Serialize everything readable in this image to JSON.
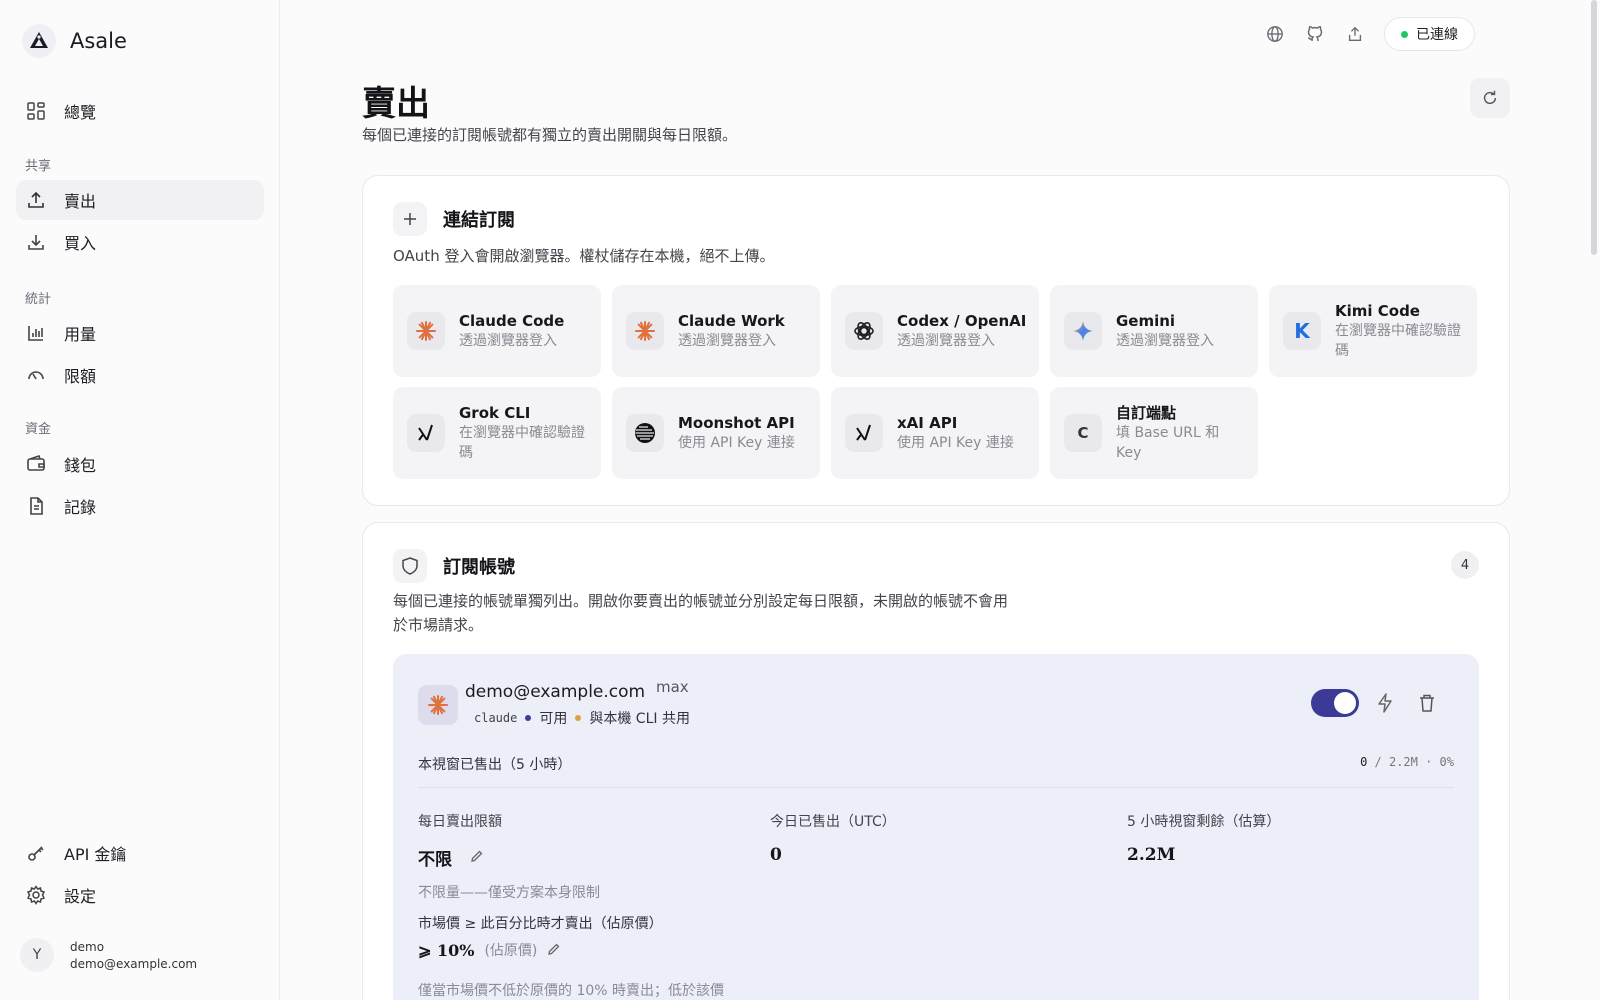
{
  "app": {
    "name": "Asale"
  },
  "sidebar": {
    "overview": "總覽",
    "sections": {
      "share": "共享",
      "stats": "統計",
      "funds": "資金"
    },
    "sell": "賣出",
    "buy": "買入",
    "usage": "用量",
    "limits": "限額",
    "wallet": "錢包",
    "records": "記錄",
    "api_keys": "API 金鑰",
    "settings": "設定",
    "user": {
      "avatar": "Y",
      "name": "demo",
      "email": "demo@example.com"
    }
  },
  "topbar": {
    "status": "已連線",
    "status_color": "#22c55e"
  },
  "page": {
    "title": "賣出",
    "subtitle": "每個已連接的訂閱帳號都有獨立的賣出開關與每日限額。"
  },
  "connect": {
    "title": "連結訂閱",
    "desc": "OAuth 登入會開啟瀏覽器。權杖儲存在本機，絕不上傳。",
    "providers": [
      {
        "name": "Claude Code",
        "sub": "透過瀏覽器登入",
        "icon": "claude-icon"
      },
      {
        "name": "Claude Work",
        "sub": "透過瀏覽器登入",
        "icon": "claude-icon"
      },
      {
        "name": "Codex / OpenAI",
        "sub": "透過瀏覽器登入",
        "icon": "openai-icon"
      },
      {
        "name": "Gemini",
        "sub": "透過瀏覽器登入",
        "icon": "gemini-icon"
      },
      {
        "name": "Kimi Code",
        "sub": "在瀏覽器中確認驗證碼",
        "icon": "kimi-icon",
        "glyph": "K"
      },
      {
        "name": "Grok CLI",
        "sub": "在瀏覽器中確認驗證碼",
        "icon": "grok-icon"
      },
      {
        "name": "Moonshot API",
        "sub": "使用 API Key 連接",
        "icon": "moonshot-icon"
      },
      {
        "name": "xAI API",
        "sub": "使用 API Key 連接",
        "icon": "xai-icon"
      },
      {
        "name": "自訂端點",
        "sub": "填 Base URL 和 Key",
        "icon": "custom-endpoint-icon",
        "glyph": "C"
      }
    ]
  },
  "accounts": {
    "title": "訂閱帳號",
    "count": "4",
    "desc_line1": "每個已連接的帳號單獨列出。開啟你要賣出的帳號並分別設定每日限額，未開啟的帳號不會用",
    "desc_line2": "於市場請求。",
    "item": {
      "email": "demo@example.com",
      "plan": "max",
      "provider": "claude",
      "status": "可用",
      "shared": "與本機 CLI 共用",
      "accent": "#3b3a96",
      "window_label": "本視窗已售出（5 小時）",
      "window_sold": "0",
      "window_rest": " / 2.2M · 0%",
      "daily_limit_label": "每日賣出限額",
      "daily_limit_value": "不限",
      "sold_today_label": "今日已售出（UTC）",
      "sold_today_value": "0",
      "window_remaining_label": "5 小時視窗剩餘（估算）",
      "window_remaining_value": "2.2M",
      "unlimited_note": "不限量——僅受方案本身限制",
      "market_label": "市場價 ≥ 此百分比時才賣出（佔原價）",
      "market_value": "⩾ 10%",
      "market_sub": "(佔原價)",
      "market_note": "僅當市場價不低於原價的 10% 時賣出；低於該價"
    }
  }
}
